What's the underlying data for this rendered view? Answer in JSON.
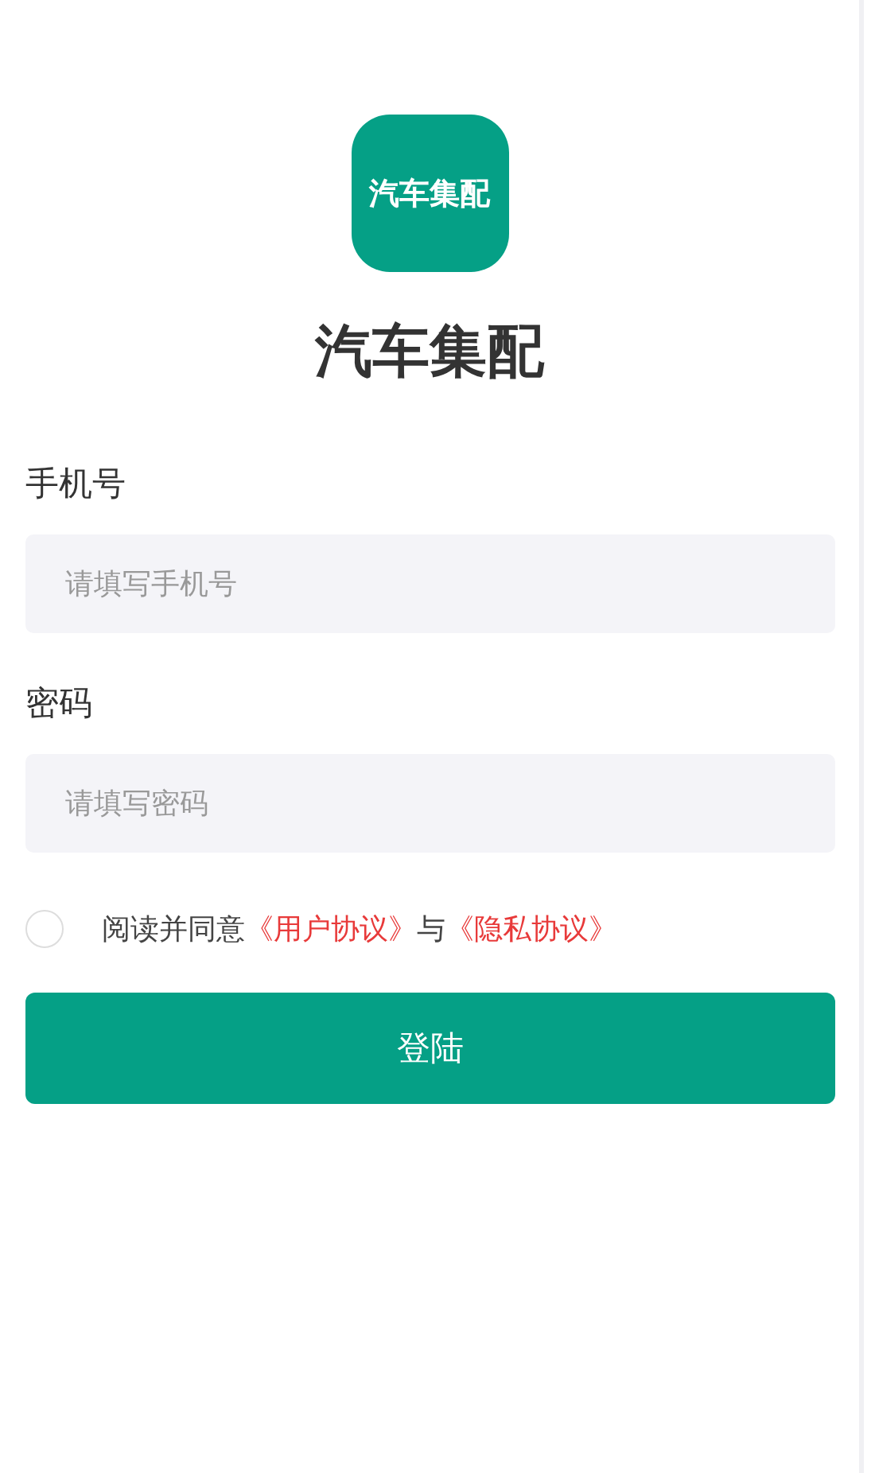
{
  "logo": {
    "text": "汽车集配"
  },
  "app_title": "汽车集配",
  "fields": [
    {
      "label": "手机号",
      "placeholder": "请填写手机号"
    },
    {
      "label": "密码",
      "placeholder": "请填写密码"
    }
  ],
  "agreement": {
    "checked": false,
    "prefix": "阅读并同意",
    "link_1": "《用户协议》",
    "joiner": "与",
    "link_2": "《隐私协议》"
  },
  "login_button": "登陆"
}
